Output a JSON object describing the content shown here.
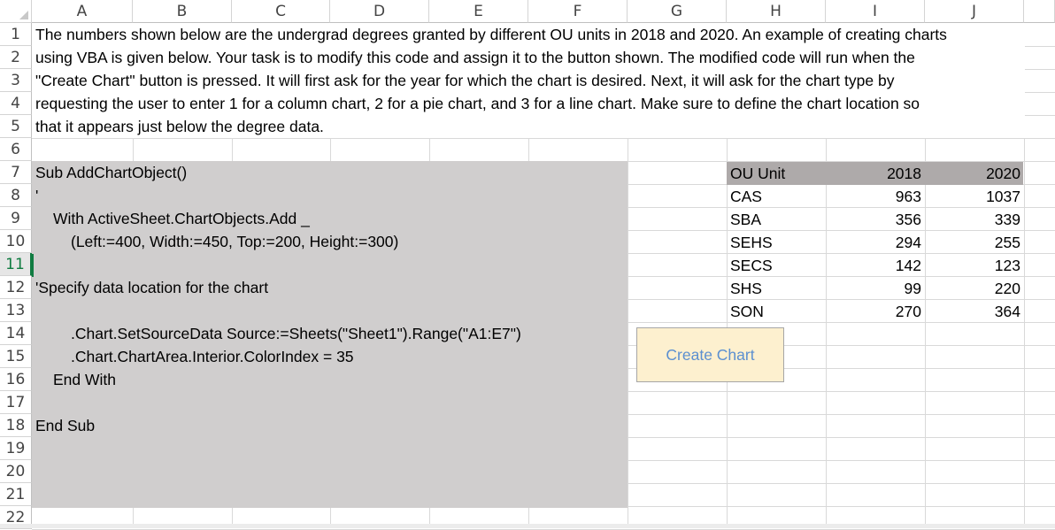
{
  "columns": [
    "A",
    "B",
    "C",
    "D",
    "E",
    "F",
    "G",
    "H",
    "I",
    "J"
  ],
  "rows": [
    "1",
    "2",
    "3",
    "4",
    "5",
    "6",
    "7",
    "8",
    "9",
    "10",
    "11",
    "12",
    "13",
    "14",
    "15",
    "16",
    "17",
    "18",
    "19",
    "20",
    "21",
    "22"
  ],
  "selected_row": "11",
  "instructions": [
    "The numbers shown below are the undergrad degrees granted by different OU units in 2018 and 2020. An example of creating charts",
    "using VBA is given below. Your task is to modify this code and assign it to the button shown. The modified code will run when the",
    "\"Create Chart\" button is pressed. It will first ask for the year for which the chart is desired. Next, it will ask for the chart type by",
    "requesting the user to enter 1 for a column chart, 2 for a pie chart, and 3 for a line chart. Make sure to define the chart location so",
    "that it appears just below the degree data."
  ],
  "code_lines": [
    {
      "row": 7,
      "indent": 0,
      "text": "Sub AddChartObject()"
    },
    {
      "row": 8,
      "indent": 0,
      "text": "'"
    },
    {
      "row": 9,
      "indent": 1,
      "text": "With ActiveSheet.ChartObjects.Add _"
    },
    {
      "row": 10,
      "indent": 2,
      "text": "(Left:=400, Width:=450, Top:=200, Height:=300)"
    },
    {
      "row": 12,
      "indent": 0,
      "text": "'Specify data location for the chart"
    },
    {
      "row": 14,
      "indent": 2,
      "text": ".Chart.SetSourceData Source:=Sheets(\"Sheet1\").Range(\"A1:E7\")"
    },
    {
      "row": 15,
      "indent": 2,
      "text": ".Chart.ChartArea.Interior.ColorIndex = 35"
    },
    {
      "row": 16,
      "indent": 1,
      "text": "End With"
    },
    {
      "row": 18,
      "indent": 0,
      "text": "End Sub"
    }
  ],
  "table": {
    "headers": [
      "OU Unit",
      "2018",
      "2020"
    ],
    "rows": [
      [
        "CAS",
        "963",
        "1037"
      ],
      [
        "SBA",
        "356",
        "339"
      ],
      [
        "SEHS",
        "294",
        "255"
      ],
      [
        "SECS",
        "142",
        "123"
      ],
      [
        "SHS",
        "99",
        "220"
      ],
      [
        "SON",
        "270",
        "364"
      ]
    ]
  },
  "button": {
    "label": "Create Chart"
  },
  "colors": {
    "code_bg": "#d0cece",
    "table_header_bg": "#aeaaaa",
    "button_bg": "#fdf0cf",
    "button_text": "#5b8fd0",
    "accent": "#107c41"
  }
}
